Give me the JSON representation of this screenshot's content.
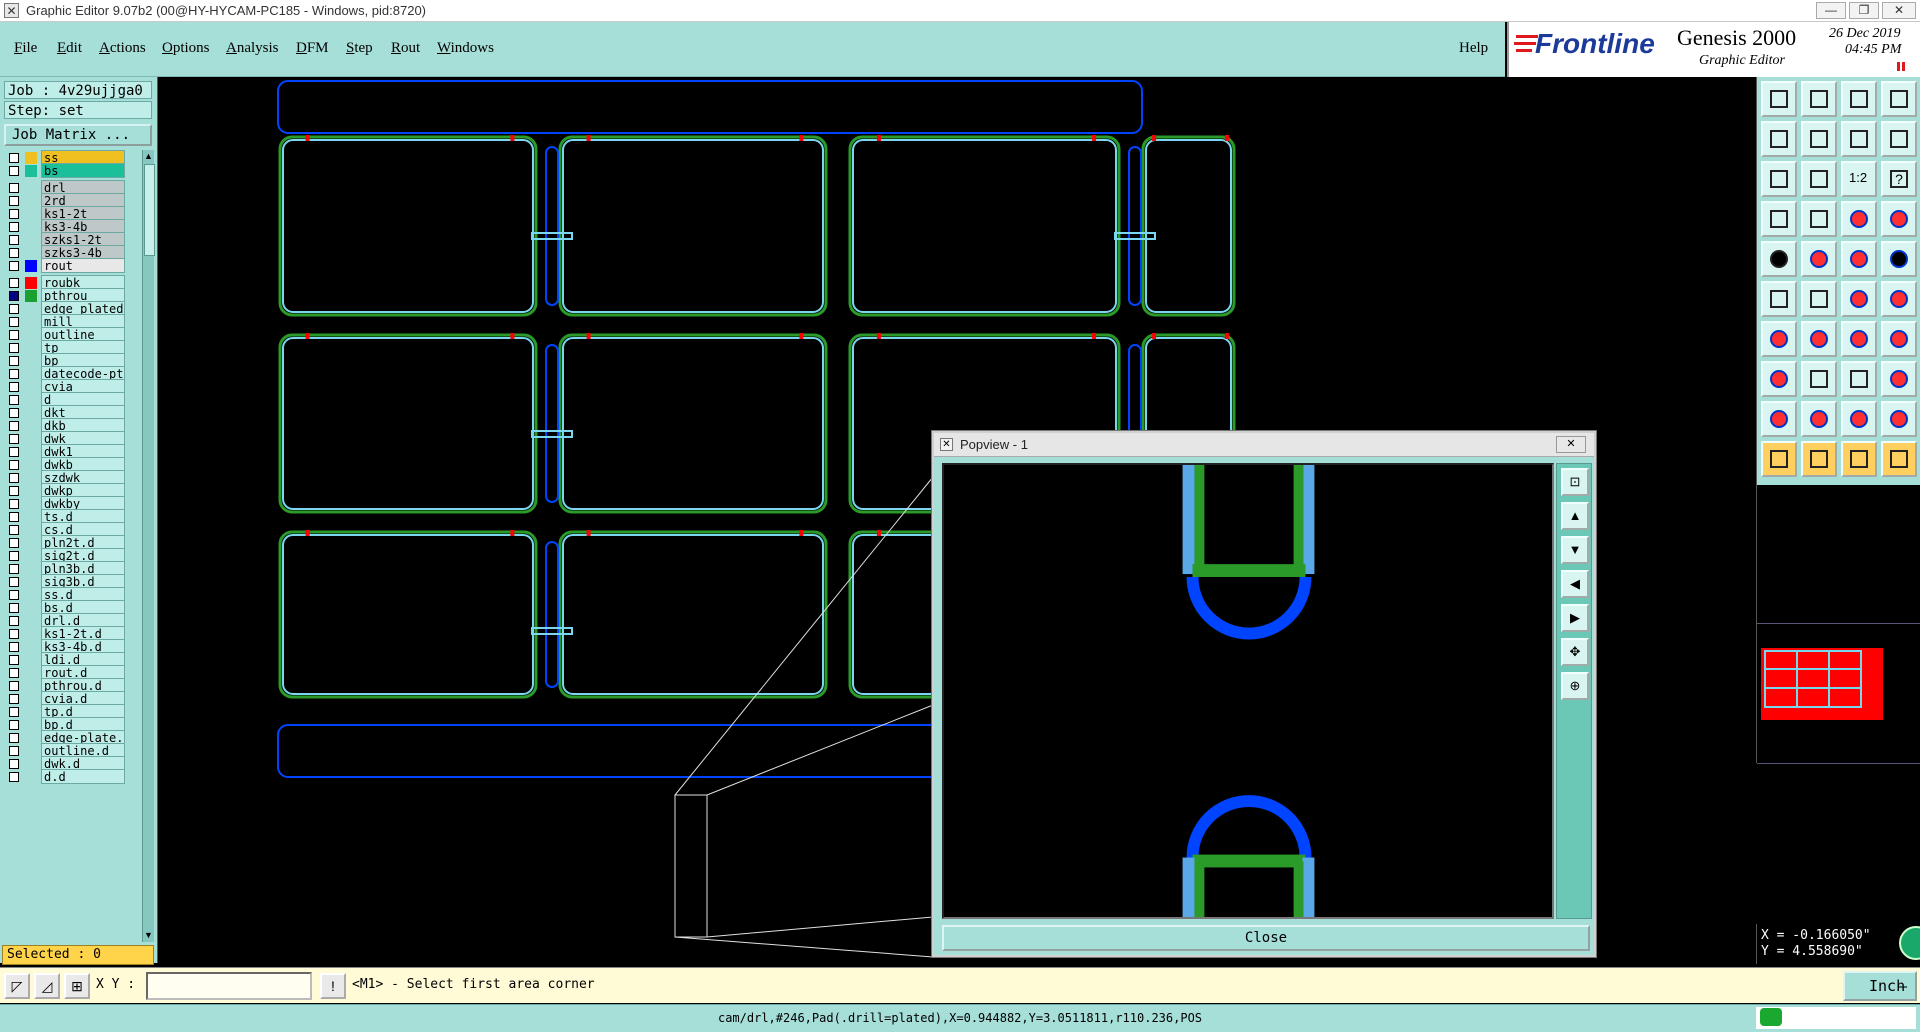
{
  "window": {
    "title": "Graphic Editor 9.07b2 (00@HY-HYCAM-PC185 - Windows, pid:8720)",
    "minimize": "—",
    "restore": "❐",
    "close": "✕"
  },
  "menu": {
    "items": [
      {
        "u": "F",
        "rest": "ile"
      },
      {
        "u": "E",
        "rest": "dit"
      },
      {
        "u": "A",
        "rest": "ctions"
      },
      {
        "u": "O",
        "rest": "ptions"
      },
      {
        "u": "A",
        "rest": "nalysis"
      },
      {
        "u": "D",
        "rest": "FM"
      },
      {
        "u": "S",
        "rest": "tep"
      },
      {
        "u": "R",
        "rest": "out"
      },
      {
        "u": "W",
        "rest": "indows"
      }
    ],
    "help": "Help"
  },
  "brand": {
    "logo": "Frontline",
    "product": "Genesis 2000",
    "subtitle": "Graphic Editor",
    "date": "26 Dec 2019",
    "time": "04:45 PM"
  },
  "job": {
    "job_line": "Job : 4v29ujjga0",
    "step_line": "Step: set",
    "matrix_button": "Job Matrix ..."
  },
  "layers": [
    {
      "name": "ss",
      "color": "#f0c020",
      "bg": "#f0c020",
      "cb": "#ffffff"
    },
    {
      "name": "bs",
      "color": "#1bbf9a",
      "bg": "#1bbf9a",
      "cb": "#ffffff"
    },
    {
      "name": "drl",
      "color": "",
      "bg": "#bfc8c8",
      "cb": "#ffffff"
    },
    {
      "name": "2rd",
      "color": "",
      "bg": "#bfc8c8",
      "cb": "#ffffff"
    },
    {
      "name": "ks1-2t",
      "color": "",
      "bg": "#bfc8c8",
      "cb": "#ffffff"
    },
    {
      "name": "ks3-4b",
      "color": "",
      "bg": "#bfc8c8",
      "cb": "#ffffff"
    },
    {
      "name": "szks1-2t",
      "color": "",
      "bg": "#bfc8c8",
      "cb": "#ffffff"
    },
    {
      "name": "szks3-4b",
      "color": "",
      "bg": "#bfc8c8",
      "cb": "#ffffff"
    },
    {
      "name": "rout",
      "color": "#0000ff",
      "bg": "#e8e8e8",
      "cb": "#ffffff"
    },
    {
      "name": "roubk",
      "color": "#ff0000",
      "bg": "#bfeee9",
      "cb": "#ffffff"
    },
    {
      "name": "pthrou",
      "color": "#1aa030",
      "bg": "#bfeee9",
      "cb": "#000080"
    },
    {
      "name": "edge_plated",
      "color": "",
      "bg": "#bfeee9",
      "cb": "#ffffff"
    },
    {
      "name": "mill",
      "color": "",
      "bg": "#bfeee9",
      "cb": "#ffffff"
    },
    {
      "name": "outline",
      "color": "",
      "bg": "#bfeee9",
      "cb": "#ffffff"
    },
    {
      "name": "tp",
      "color": "",
      "bg": "#bfeee9",
      "cb": "#ffffff"
    },
    {
      "name": "bp",
      "color": "",
      "bg": "#bfeee9",
      "cb": "#ffffff"
    },
    {
      "name": "datecode-pth",
      "color": "",
      "bg": "#bfeee9",
      "cb": "#ffffff"
    },
    {
      "name": "cvia",
      "color": "",
      "bg": "#bfeee9",
      "cb": "#ffffff"
    },
    {
      "name": "d",
      "color": "",
      "bg": "#bfeee9",
      "cb": "#ffffff"
    },
    {
      "name": "dkt",
      "color": "",
      "bg": "#bfeee9",
      "cb": "#ffffff"
    },
    {
      "name": "dkb",
      "color": "",
      "bg": "#bfeee9",
      "cb": "#ffffff"
    },
    {
      "name": "dwk",
      "color": "",
      "bg": "#bfeee9",
      "cb": "#ffffff"
    },
    {
      "name": "dwk1",
      "color": "",
      "bg": "#bfeee9",
      "cb": "#ffffff"
    },
    {
      "name": "dwkb",
      "color": "",
      "bg": "#bfeee9",
      "cb": "#ffffff"
    },
    {
      "name": "szdwk",
      "color": "",
      "bg": "#bfeee9",
      "cb": "#ffffff"
    },
    {
      "name": "dwkp",
      "color": "",
      "bg": "#bfeee9",
      "cb": "#ffffff"
    },
    {
      "name": "dwkby",
      "color": "",
      "bg": "#bfeee9",
      "cb": "#ffffff"
    },
    {
      "name": "ts.d",
      "color": "",
      "bg": "#bfeee9",
      "cb": "#ffffff"
    },
    {
      "name": "cs.d",
      "color": "",
      "bg": "#bfeee9",
      "cb": "#ffffff"
    },
    {
      "name": "pln2t.d",
      "color": "",
      "bg": "#bfeee9",
      "cb": "#ffffff"
    },
    {
      "name": "sig2t.d",
      "color": "",
      "bg": "#bfeee9",
      "cb": "#ffffff"
    },
    {
      "name": "pln3b.d",
      "color": "",
      "bg": "#bfeee9",
      "cb": "#ffffff"
    },
    {
      "name": "sig3b.d",
      "color": "",
      "bg": "#bfeee9",
      "cb": "#ffffff"
    },
    {
      "name": "ss.d",
      "color": "",
      "bg": "#bfeee9",
      "cb": "#ffffff"
    },
    {
      "name": "bs.d",
      "color": "",
      "bg": "#bfeee9",
      "cb": "#ffffff"
    },
    {
      "name": "drl.d",
      "color": "",
      "bg": "#bfeee9",
      "cb": "#ffffff"
    },
    {
      "name": "ks1-2t.d",
      "color": "",
      "bg": "#bfeee9",
      "cb": "#ffffff"
    },
    {
      "name": "ks3-4b.d",
      "color": "",
      "bg": "#bfeee9",
      "cb": "#ffffff"
    },
    {
      "name": "ldi.d",
      "color": "",
      "bg": "#bfeee9",
      "cb": "#ffffff"
    },
    {
      "name": "rout.d",
      "color": "",
      "bg": "#bfeee9",
      "cb": "#ffffff"
    },
    {
      "name": "pthrou.d",
      "color": "",
      "bg": "#bfeee9",
      "cb": "#ffffff"
    },
    {
      "name": "cvia.d",
      "color": "",
      "bg": "#bfeee9",
      "cb": "#ffffff"
    },
    {
      "name": "tp.d",
      "color": "",
      "bg": "#bfeee9",
      "cb": "#ffffff"
    },
    {
      "name": "bp.d",
      "color": "",
      "bg": "#bfeee9",
      "cb": "#ffffff"
    },
    {
      "name": "edge-plate.d",
      "color": "",
      "bg": "#bfeee9",
      "cb": "#ffffff"
    },
    {
      "name": "outline.d",
      "color": "",
      "bg": "#bfeee9",
      "cb": "#ffffff"
    },
    {
      "name": "dwk.d",
      "color": "",
      "bg": "#bfeee9",
      "cb": "#ffffff"
    },
    {
      "name": "d.d",
      "color": "",
      "bg": "#bfeee9",
      "cb": "#ffffff"
    }
  ],
  "selected": "Selected : 0",
  "toolbox": {
    "labels": [
      "1:2",
      "?"
    ]
  },
  "coords": {
    "x": "X = -0.166050\"",
    "y": "Y = 4.558690\""
  },
  "cmd": {
    "xy_label": "X Y :",
    "xy_value": "",
    "pause": "!",
    "prompt": "<M1> - Select first area corner",
    "units": "Inch"
  },
  "status": {
    "text": "cam/drl,#246,Pad(.drill=plated),X=0.944882,Y=3.0511811,r110.236,POS"
  },
  "popview": {
    "title": "Popview - 1",
    "close_x": "✕",
    "close_button": "Close"
  },
  "colors": {
    "panel": "#a6ded8",
    "rout": "#0044ff",
    "pthrou": "#2a9a28",
    "cyan": "#7ad7ef",
    "roubk": "#ff0000",
    "selected": "#ffd34a"
  }
}
